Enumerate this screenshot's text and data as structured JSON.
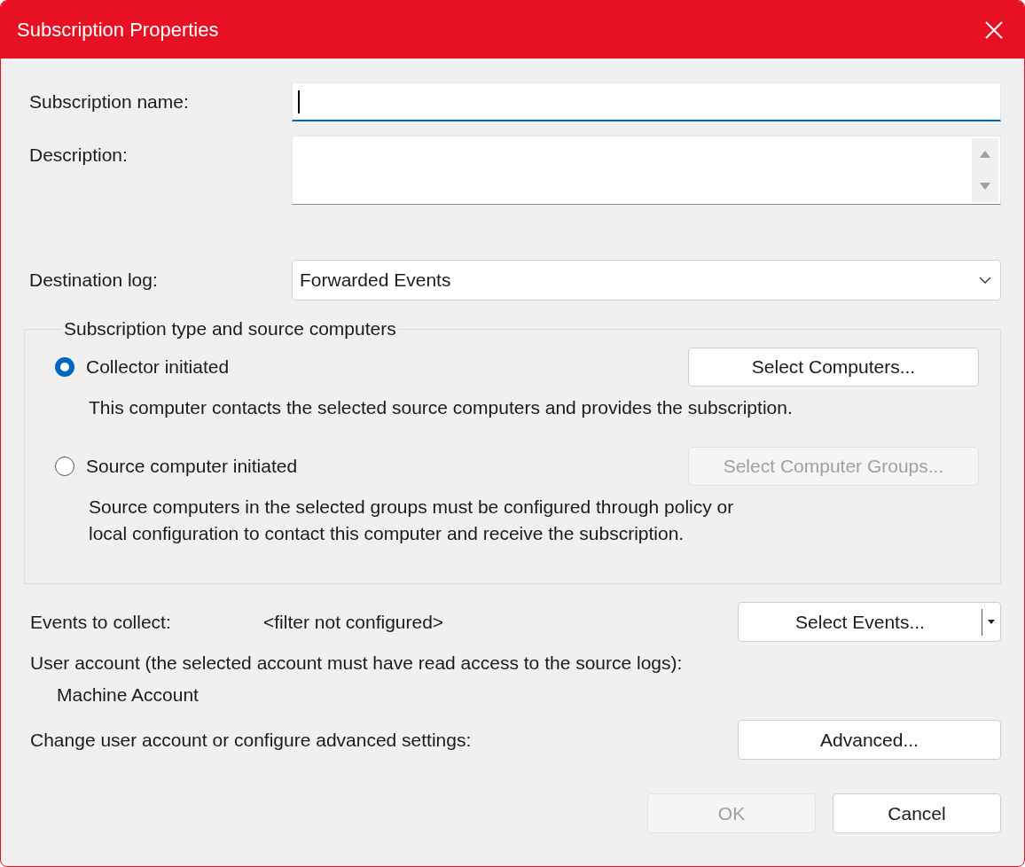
{
  "window": {
    "title": "Subscription Properties"
  },
  "subscription_name": {
    "label": "Subscription name:",
    "focused": true
  },
  "description": {
    "label": "Description:"
  },
  "destination_log": {
    "label": "Destination log:",
    "value": "Forwarded Events"
  },
  "subscription_type": {
    "legend": "Subscription type and source computers",
    "options": [
      {
        "label": "Collector initiated",
        "selected": true,
        "button": {
          "label": "Select Computers...",
          "disabled": false
        },
        "description_lines": [
          "This computer contacts the selected source computers and provides the subscription."
        ]
      },
      {
        "label": "Source computer initiated",
        "selected": false,
        "button": {
          "label": "Select Computer Groups...",
          "disabled": true
        },
        "description_lines": [
          "Source computers in the selected groups must be configured through policy or",
          "local configuration to contact this computer and receive the subscription."
        ]
      }
    ]
  },
  "events": {
    "label": "Events to collect:",
    "value": "<filter not configured>",
    "button": "Select Events..."
  },
  "user_account": {
    "label": "User account (the selected account must have read access to the source logs):",
    "value": "Machine Account"
  },
  "advanced": {
    "label": "Change user account or configure advanced settings:",
    "button": "Advanced..."
  },
  "footer_buttons": [
    {
      "label": "OK",
      "disabled": true
    },
    {
      "label": "Cancel",
      "disabled": false
    }
  ]
}
